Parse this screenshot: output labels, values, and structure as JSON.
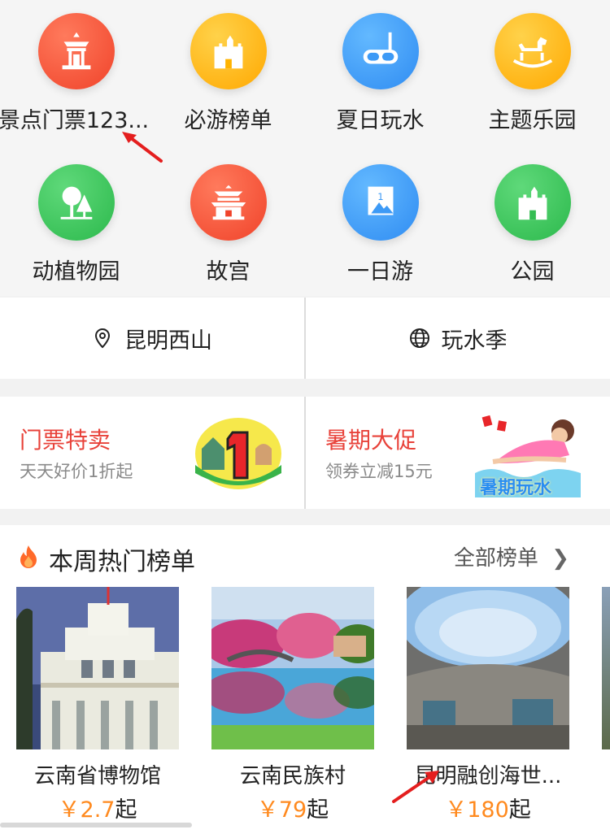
{
  "categories": [
    {
      "label": "景点门票123...",
      "icon": "pavilion-icon",
      "color": "red"
    },
    {
      "label": "必游榜单",
      "icon": "castle-icon",
      "color": "yellow"
    },
    {
      "label": "夏日玩水",
      "icon": "snorkel-mask-icon",
      "color": "blue"
    },
    {
      "label": "主题乐园",
      "icon": "rocking-horse-icon",
      "color": "yellow"
    },
    {
      "label": "动植物园",
      "icon": "tree-icon",
      "color": "green"
    },
    {
      "label": "故宫",
      "icon": "palace-icon",
      "color": "red"
    },
    {
      "label": "一日游",
      "icon": "flag-mountain-icon",
      "color": "blue"
    },
    {
      "label": "公园",
      "icon": "castle-icon",
      "color": "green"
    }
  ],
  "locations": [
    {
      "label": "昆明西山",
      "icon": "location-pin-icon"
    },
    {
      "label": "玩水季",
      "icon": "globe-icon"
    }
  ],
  "promos": [
    {
      "title": "门票特卖",
      "subtitle": "天天好价1折起"
    },
    {
      "title": "暑期大促",
      "subtitle": "领券立减15元"
    }
  ],
  "promo_art": {
    "summer_badge": "暑期玩水"
  },
  "ranking": {
    "title": "本周热门榜单",
    "more_label": "全部榜单",
    "items": [
      {
        "name": "云南省博物馆",
        "currency": "￥",
        "price": "2.7",
        "suffix": "起"
      },
      {
        "name": "云南民族村",
        "currency": "￥",
        "price": "79",
        "suffix": "起"
      },
      {
        "name": "昆明融创海世...",
        "currency": "￥",
        "price": "180",
        "suffix": "起"
      }
    ]
  },
  "colors": {
    "accent_red": "#e8423a",
    "price_orange": "#ff8a1f"
  }
}
